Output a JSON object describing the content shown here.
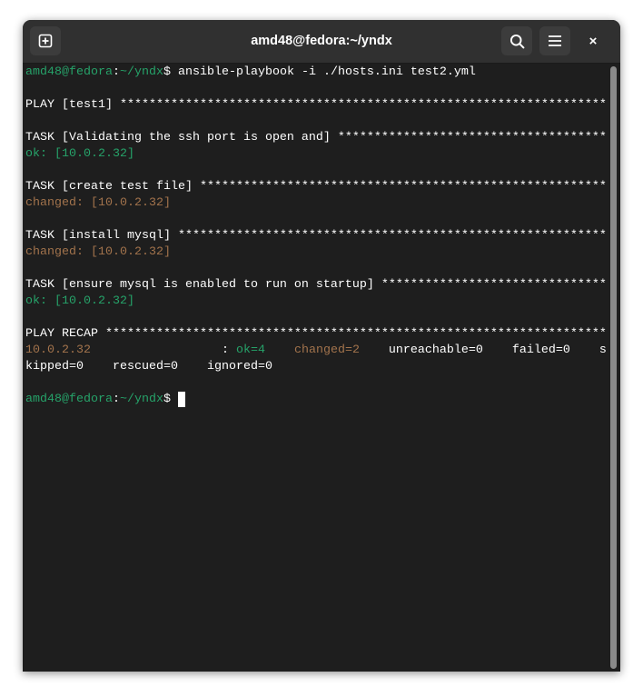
{
  "window": {
    "title": "amd48@fedora:~/yndx"
  },
  "header": {
    "new_tab_icon": "plus-square-icon",
    "search_icon": "search-icon",
    "menu_icon": "hamburger-menu-icon",
    "close_label": "×"
  },
  "colors": {
    "background": "#1e1e1e",
    "header": "#303030",
    "green": "#26a269",
    "orange": "#a2734c",
    "text": "#ffffff"
  },
  "terminal": {
    "lines": [
      [
        {
          "t": "amd48@fedora",
          "c": "green"
        },
        {
          "t": ":",
          "c": ""
        },
        {
          "t": "~/yndx",
          "c": "green"
        },
        {
          "t": "$ ansible-playbook -i ./hosts.ini test2.yml",
          "c": ""
        }
      ],
      [],
      [
        {
          "t": "PLAY [test1] ***********************************************************************************",
          "c": ""
        }
      ],
      [],
      [
        {
          "t": "TASK [Validating the ssh port is open and] *********************************************************",
          "c": ""
        }
      ],
      [
        {
          "t": "ok: [10.0.2.32]",
          "c": "green"
        }
      ],
      [],
      [
        {
          "t": "TASK [create test file] ****************************************************************************",
          "c": ""
        }
      ],
      [
        {
          "t": "changed: [10.0.2.32]",
          "c": "orange"
        }
      ],
      [],
      [
        {
          "t": "TASK [install mysql] *******************************************************************************",
          "c": ""
        }
      ],
      [
        {
          "t": "changed: [10.0.2.32]",
          "c": "orange"
        }
      ],
      [],
      [
        {
          "t": "TASK [ensure mysql is enabled to run on startup] ***************************************************",
          "c": ""
        }
      ],
      [
        {
          "t": "ok: [10.0.2.32]",
          "c": "green"
        }
      ],
      [],
      [
        {
          "t": "PLAY RECAP *****************************************************************************************",
          "c": ""
        }
      ],
      [
        {
          "t": "10.0.2.32",
          "c": "orange"
        },
        {
          "t": "                  : ",
          "c": ""
        },
        {
          "t": "ok=4",
          "c": "green"
        },
        {
          "t": "    ",
          "c": ""
        },
        {
          "t": "changed=2",
          "c": "orange"
        },
        {
          "t": "    unreachable=0    failed=0    s",
          "c": ""
        }
      ],
      [
        {
          "t": "kipped=0    rescued=0    ignored=0",
          "c": ""
        }
      ],
      [],
      [
        {
          "t": "amd48@fedora",
          "c": "green"
        },
        {
          "t": ":",
          "c": ""
        },
        {
          "t": "~/yndx",
          "c": "green"
        },
        {
          "t": "$ ",
          "c": ""
        }
      ]
    ]
  }
}
